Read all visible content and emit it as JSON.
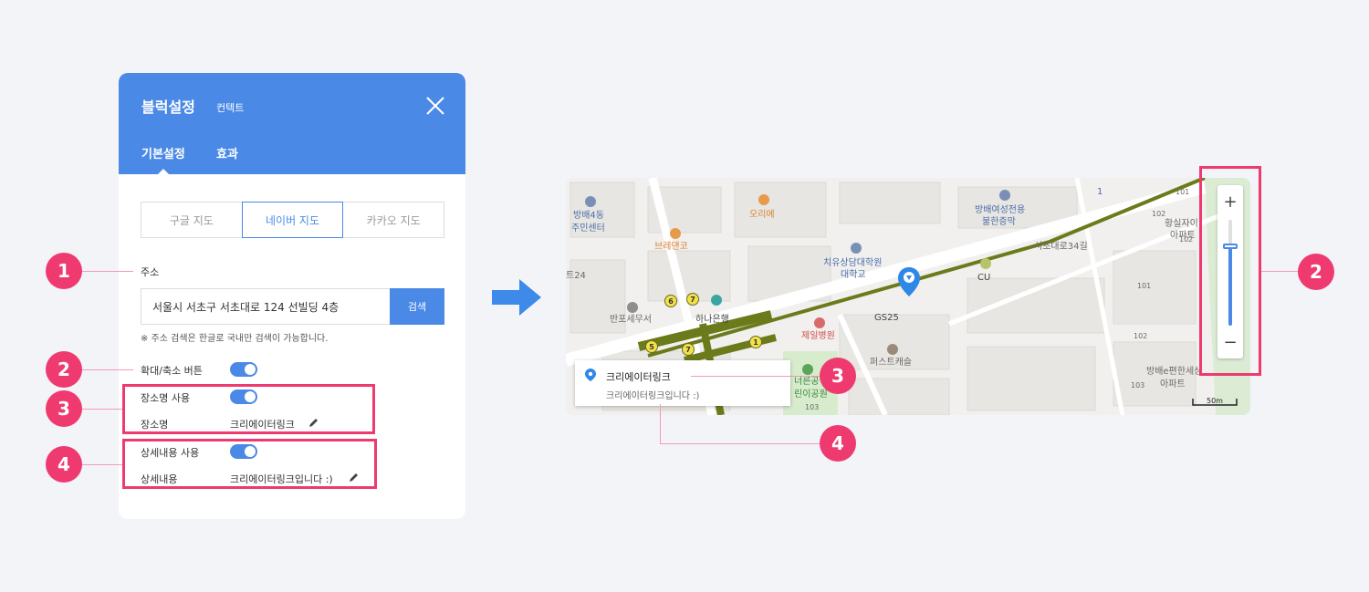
{
  "panel": {
    "title": "블럭설정",
    "subtitle": "컨텍트",
    "tabs": {
      "basic": "기본설정",
      "effect": "효과"
    },
    "map_tabs": [
      "구글 지도",
      "네이버 지도",
      "카카오 지도"
    ],
    "active_map_tab": "네이버 지도",
    "address": {
      "label": "주소",
      "value": "서울시 서초구 서초대로 124 선빌딩 4층",
      "search_button": "검색",
      "help": "※ 주소 검색은 한글로 국내만 검색이 가능합니다."
    },
    "zoom_toggle": {
      "label": "확대/축소 버튼",
      "on": true
    },
    "place_name_toggle": {
      "label": "장소명 사용",
      "on": true
    },
    "place_name": {
      "label": "장소명",
      "value": "크리에이터링크"
    },
    "detail_toggle": {
      "label": "상세내용 사용",
      "on": true
    },
    "detail": {
      "label": "상세내용",
      "value": "크리에이터링크입니다 :)"
    }
  },
  "annotations": [
    "1",
    "2",
    "3",
    "4"
  ],
  "map": {
    "labels": {
      "l1": "방배4동",
      "l2": "주민센터",
      "l3": "브레댄코",
      "l4": "오리에",
      "l5": "방배여성전용",
      "l6": "불한증막",
      "l7": "치유상담대학원",
      "l8": "대학교",
      "l9": "서초대로34길",
      "l10": "CU",
      "l11": "GS25",
      "l12": "반포세무서",
      "l13": "하나은행",
      "l14": "제일병원",
      "l15": "퍼스트캐슬",
      "l16": "트24",
      "l17": "황실자이",
      "l18": "아파트",
      "l19": "101",
      "l20": "102",
      "l21": "102",
      "l22": "101",
      "l23": "102",
      "l24": "103",
      "l25": "방배e편한세상",
      "l26": "아파트",
      "l27": "너른공",
      "l28": "린이공원",
      "l29": "103",
      "l30": "1"
    },
    "stations": [
      "6",
      "7",
      "5",
      "7",
      "1"
    ],
    "info_title": "크리에이터링크",
    "info_desc": "크리에이터링크입니다 :)",
    "scale": "50m",
    "zoom_in": "+",
    "zoom_out": "−",
    "zoom_level": 0.75
  },
  "colors": {
    "accent": "#4a89e6",
    "highlight": "#ee3a6e"
  },
  "icons": [
    "close-icon",
    "pencil-icon",
    "arrow-right-icon",
    "map-marker-icon",
    "location-pin-icon"
  ]
}
